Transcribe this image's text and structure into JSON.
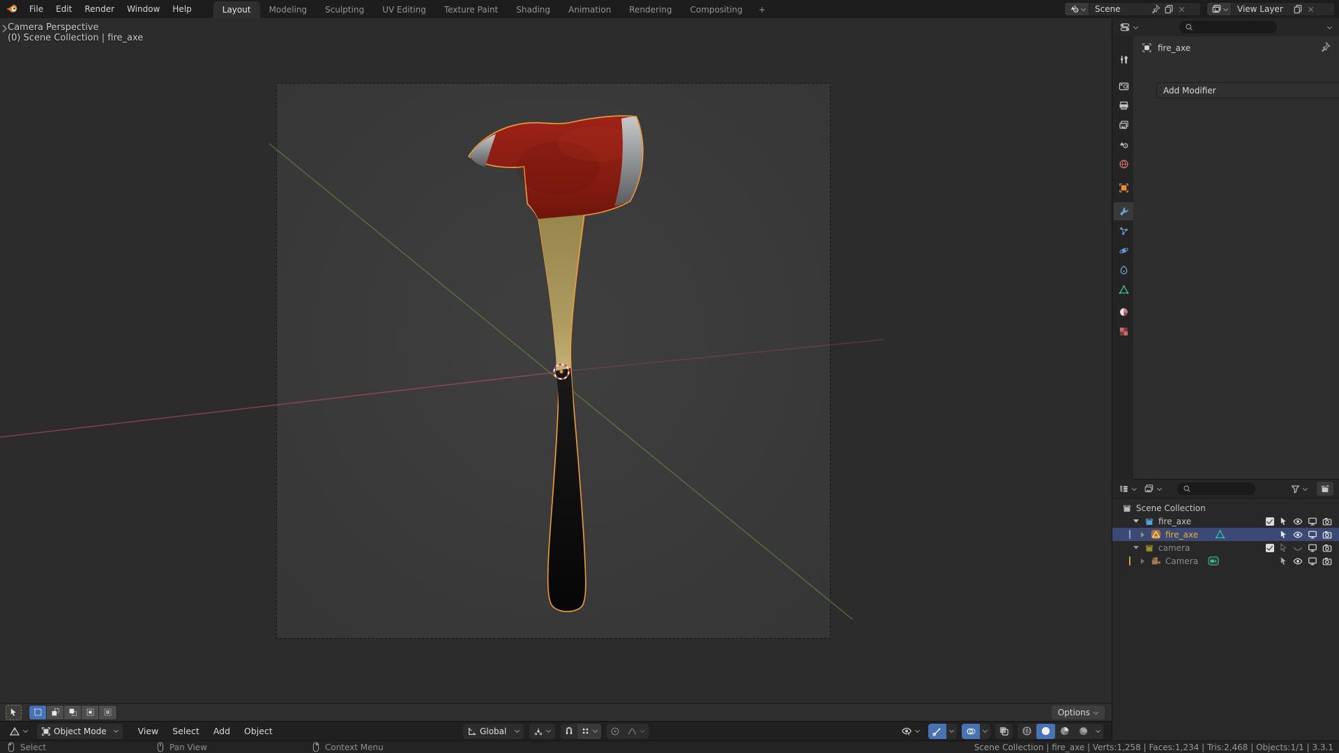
{
  "topbar": {
    "logo_icon": "blender-logo-icon",
    "menus": [
      "File",
      "Edit",
      "Render",
      "Window",
      "Help"
    ],
    "tabs": [
      "Layout",
      "Modeling",
      "Sculpting",
      "UV Editing",
      "Texture Paint",
      "Shading",
      "Animation",
      "Rendering",
      "Compositing"
    ],
    "active_tab": "Layout",
    "add_workspace_label": "+",
    "scene_selector": {
      "icon": "scene-icon",
      "label": "Scene"
    },
    "view_layer_selector": {
      "icon": "view-layer-icon",
      "label": "View Layer"
    }
  },
  "viewport": {
    "overlay": {
      "line1": "Camera Perspective",
      "line2": "(0) Scene Collection | fire_axe"
    },
    "tool_settings": {
      "options_label": "Options",
      "active_tool": "select-box"
    },
    "header": {
      "mode_label": "Object Mode",
      "menus": [
        "View",
        "Select",
        "Add",
        "Object"
      ],
      "orientation_label": "Global",
      "shading_active": "solid"
    }
  },
  "properties": {
    "breadcrumb_object": "fire_axe",
    "add_modifier_label": "Add Modifier",
    "tab_icons": [
      "tool",
      "render",
      "output",
      "view-layer",
      "scene",
      "world",
      "object",
      "modifiers",
      "particles",
      "physics",
      "constraints",
      "object-data",
      "material",
      "texture"
    ],
    "active_tab": "modifiers"
  },
  "outliner": {
    "rows": [
      {
        "label": "Scene Collection",
        "type": "collection"
      },
      {
        "label": "fire_axe",
        "type": "collection"
      },
      {
        "label": "fire_axe",
        "type": "mesh-object",
        "selected": true
      },
      {
        "label": "camera",
        "type": "collection"
      },
      {
        "label": "Camera",
        "type": "camera-object"
      }
    ]
  },
  "statusbar": {
    "hints": [
      "Select",
      "Pan View",
      "Context Menu"
    ],
    "stats": "Scene Collection | fire_axe | Verts:1,258 | Faces:1,234 | Tris:2,468 | Objects:1/1 | 3.3.1"
  },
  "colors": {
    "accent_blue": "#4772b3",
    "selection_outline_orange": "#f59d38",
    "selected_row_blue": "#3a4a74",
    "axe_head_red": "#8e1f16",
    "axe_steel": "#9fa1a4",
    "handle_wood": "#ab9a5e",
    "handle_grip_black": "#0c0c0c"
  }
}
